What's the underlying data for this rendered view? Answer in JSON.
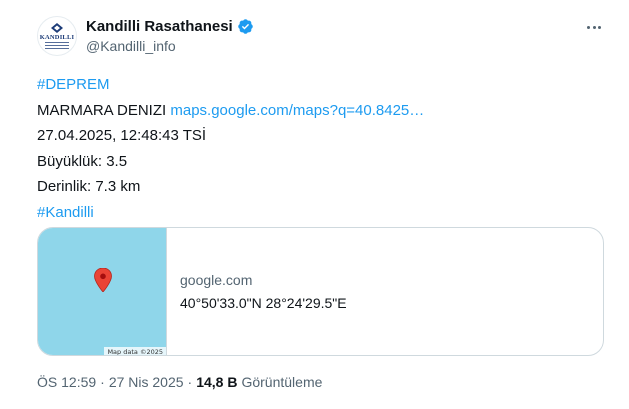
{
  "profile": {
    "display_name": "Kandilli Rasathanesi",
    "handle": "@Kandilli_info",
    "avatar_text": "KANDILLI",
    "verified_icon": "verified-badge-icon",
    "verified_color": "#1d9bf0"
  },
  "more_icon": "more-options-icon",
  "tweet": {
    "hashtag_1": "#DEPREM",
    "location": "MARMARA DENIZI",
    "map_link": "maps.google.com/maps?q=40.8425…",
    "datetime": "27.04.2025, 12:48:43 TSİ",
    "magnitude": "Büyüklük: 3.5",
    "depth": "Derinlik: 7.3 km",
    "hashtag_2": "#Kandilli"
  },
  "card": {
    "domain": "google.com",
    "coordinates": "40°50'33.0\"N 28°24'29.5\"E",
    "map_credit": "Map data ©2025",
    "pin_icon": "map-pin-icon",
    "map_color": "#8fd6ea",
    "pin_color": "#ea4335"
  },
  "meta": {
    "time": "ÖS 12:59",
    "separator_1": "·",
    "date": "27 Nis 2025",
    "separator_2": "·",
    "views_count": "14,8 B",
    "views_label": "Görüntüleme"
  },
  "colors": {
    "link": "#1d9bf0",
    "text": "#0f1419",
    "secondary": "#536471",
    "border": "#cfd9de"
  }
}
